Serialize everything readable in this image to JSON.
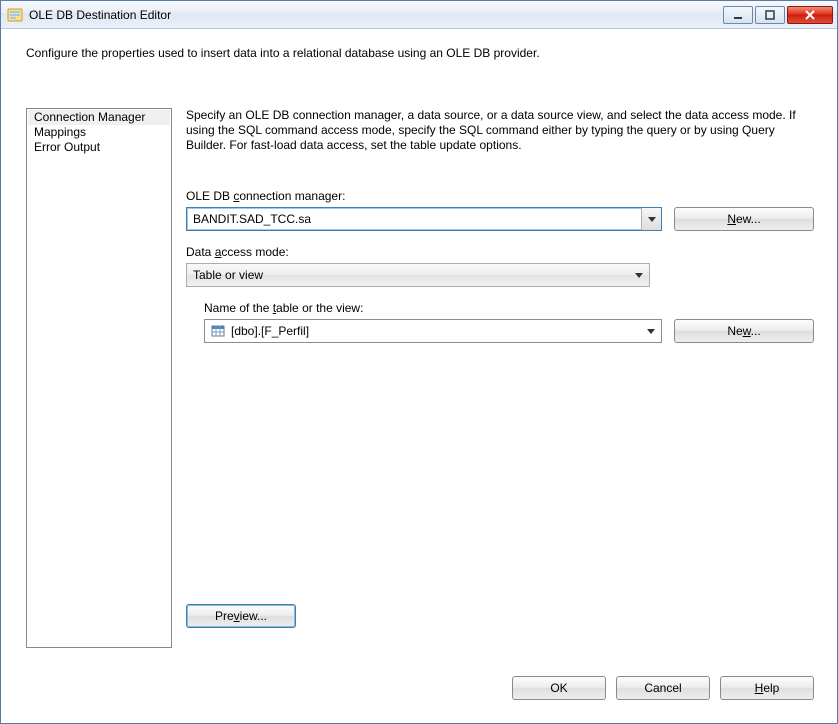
{
  "window": {
    "title": "OLE DB Destination Editor"
  },
  "instruction": "Configure the properties used to insert data into a relational database using an OLE DB provider.",
  "sidebar": {
    "items": [
      {
        "label": "Connection Manager",
        "selected": true
      },
      {
        "label": "Mappings"
      },
      {
        "label": "Error Output"
      }
    ]
  },
  "main": {
    "description": "Specify an OLE DB connection manager, a data source, or a data source view, and select the data access mode. If using the SQL command access mode, specify the SQL command either by typing the query or by using Query Builder. For fast-load data access, set the table update options.",
    "conn_label_pre": "OLE DB ",
    "conn_label_u": "c",
    "conn_label_post": "onnection manager:",
    "conn_value": "BANDIT.SAD_TCC.sa",
    "new1_pre": "",
    "new1_u": "N",
    "new1_post": "ew...",
    "mode_label_pre": "Data ",
    "mode_label_u": "a",
    "mode_label_post": "ccess mode:",
    "mode_value": "Table or view",
    "table_label_pre": "Name of the ",
    "table_label_u": "t",
    "table_label_post": "able or the view:",
    "table_value": "[dbo].[F_Perfil]",
    "new2_pre": "Ne",
    "new2_u": "w",
    "new2_post": "...",
    "preview_pre": "Pre",
    "preview_u": "v",
    "preview_post": "iew..."
  },
  "footer": {
    "ok": "OK",
    "cancel": "Cancel",
    "help_u": "H",
    "help_post": "elp"
  }
}
